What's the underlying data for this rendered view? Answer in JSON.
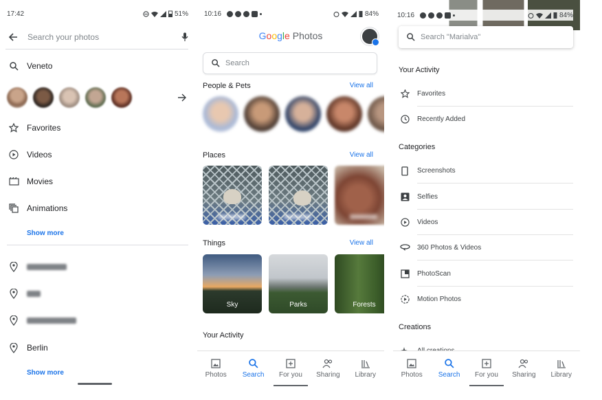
{
  "screens": {
    "search_input": {
      "status": {
        "time": "17:42",
        "battery": "51%"
      },
      "search_placeholder": "Search your photos",
      "recent_query": "Veneto",
      "categories": [
        {
          "label": "Favorites",
          "icon": "star-icon"
        },
        {
          "label": "Videos",
          "icon": "play-circle-icon"
        },
        {
          "label": "Movies",
          "icon": "movie-icon"
        },
        {
          "label": "Animations",
          "icon": "animation-icon"
        }
      ],
      "show_more_1": "Show more",
      "places": [
        {
          "label": "",
          "redacted": true
        },
        {
          "label": "",
          "redacted": true
        },
        {
          "label": "",
          "redacted": true
        },
        {
          "label": "Berlin",
          "redacted": false
        }
      ],
      "show_more_2": "Show more"
    },
    "search_explore": {
      "status": {
        "time": "10:16",
        "battery": "84%"
      },
      "logo": "Google Photos",
      "search_placeholder": "Search",
      "people_title": "People & Pets",
      "people_viewall": "View all",
      "places_title": "Places",
      "places_viewall": "View all",
      "things_title": "Things",
      "things_viewall": "View all",
      "things": [
        "Sky",
        "Parks",
        "Forests"
      ],
      "activity_title": "Your Activity"
    },
    "search_scrolled": {
      "status": {
        "time": "10:16",
        "battery": "84%"
      },
      "search_placeholder": "Search \"Marialva\"",
      "activity_title": "Your Activity",
      "activity": [
        {
          "label": "Favorites",
          "icon": "star-icon"
        },
        {
          "label": "Recently Added",
          "icon": "clock-icon"
        }
      ],
      "categories_title": "Categories",
      "categories": [
        {
          "label": "Screenshots",
          "icon": "phone-icon"
        },
        {
          "label": "Selfies",
          "icon": "portrait-icon"
        },
        {
          "label": "Videos",
          "icon": "play-circle-icon"
        },
        {
          "label": "360 Photos & Videos",
          "icon": "panorama-icon"
        },
        {
          "label": "PhotoScan",
          "icon": "photoscan-icon"
        },
        {
          "label": "Motion Photos",
          "icon": "motion-icon"
        }
      ],
      "creations_title": "Creations",
      "creations": [
        {
          "label": "All creations",
          "icon": "sparkle-icon"
        }
      ]
    }
  },
  "bottom_nav": [
    {
      "label": "Photos",
      "icon": "photo-icon"
    },
    {
      "label": "Search",
      "icon": "search-icon",
      "active": true
    },
    {
      "label": "For you",
      "icon": "add-box-icon"
    },
    {
      "label": "Sharing",
      "icon": "people-icon"
    },
    {
      "label": "Library",
      "icon": "library-icon"
    }
  ],
  "colors": {
    "accent": "#1a73e8",
    "text": "#202124",
    "muted": "#5f6368"
  }
}
